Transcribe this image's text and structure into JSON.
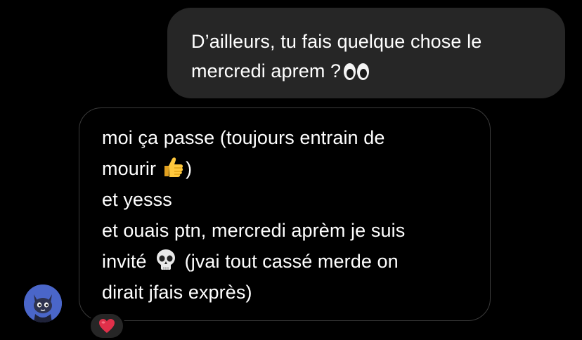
{
  "sent_message": {
    "lines": [
      "D’ailleurs, tu fais quelque chose le",
      "mercredi aprem ?"
    ],
    "emoji": "eyes-emoji"
  },
  "received_message": {
    "lines": [
      "moi ça passe (toujours entrain de",
      "mourir",
      ")",
      "et yesss",
      "et ouais ptn, mercredi aprèm je suis",
      "invité",
      "(jvai tout cassé merde on",
      "dirait jfais exprès)"
    ],
    "emojis": [
      "thumbs-up-emoji",
      "skull-emoji"
    ]
  },
  "reaction": {
    "emoji": "red-heart-emoji"
  },
  "colors": {
    "background": "#000000",
    "sent_bubble": "#262626",
    "received_bubble_border": "#3a3a3a",
    "text": "#ffffff",
    "avatar": "#4a66c9",
    "heart": "#e0304a"
  }
}
